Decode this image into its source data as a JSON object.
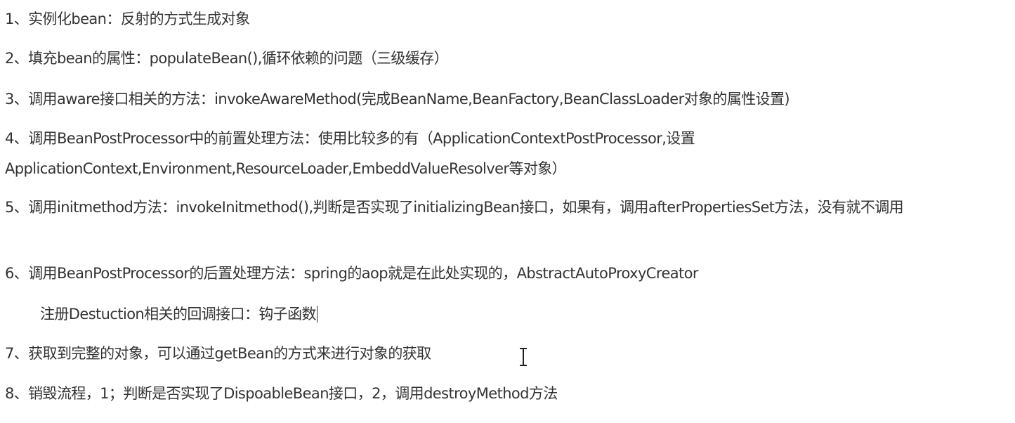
{
  "items": [
    "1、实例化bean：反射的方式生成对象",
    "2、填充bean的属性：populateBean(),循环依赖的问题（三级缓存）",
    "3、调用aware接口相关的方法：invokeAwareMethod(完成BeanName,BeanFactory,BeanClassLoader对象的属性设置)",
    "4、调用BeanPostProcessor中的前置处理方法：使用比较多的有（ApplicationContextPostProcessor,设置ApplicationContext,Environment,ResourceLoader,EmbeddValueResolver等对象）",
    "5、调用initmethod方法：invokeInitmethod(),判断是否实现了initializingBean接口，如果有，调用afterPropertiesSet方法，没有就不调用",
    "6、调用BeanPostProcessor的后置处理方法：spring的aop就是在此处实现的，AbstractAutoProxyCreator",
    "注册Destuction相关的回调接口：钩子函数",
    "7、获取到完整的对象，可以通过getBean的方式来进行对象的获取",
    "8、销毁流程，1；判断是否实现了DispoableBean接口，2，调用destroyMethod方法"
  ]
}
